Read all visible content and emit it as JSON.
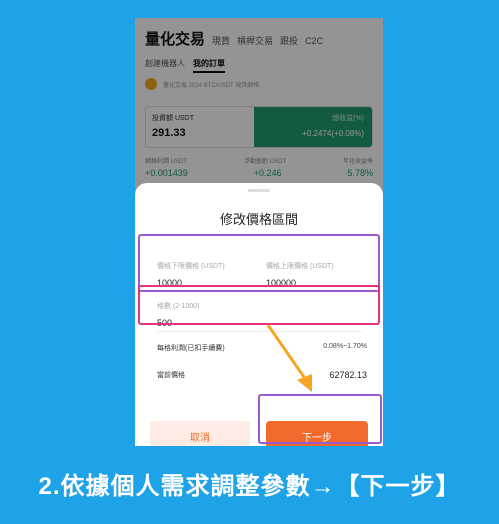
{
  "app": {
    "title": "量化交易",
    "tabs": [
      "現貨",
      "槓桿交易",
      "跟投",
      "C2C"
    ],
    "subtabs": [
      "創建機器人",
      "我的訂單"
    ],
    "coin_text": "量化交易 2024 BTC/USDT 現貨網格",
    "card": {
      "label": "投資額 USDT",
      "value": "291.33",
      "right_label": "總收益(%)",
      "right_value": "+0.2474(+0.08%)"
    },
    "stats_labels": [
      "網格利潤 USDT",
      "浮動盈虧 USDT",
      "年化收益率"
    ],
    "stats_values": [
      "+0.001439",
      "+0.246",
      "5.78%"
    ]
  },
  "sheet": {
    "title": "修改價格區間",
    "lower": {
      "label": "價格下限價格 (USDT)",
      "value": "10000"
    },
    "upper": {
      "label": "價格上限價格 (USDT)",
      "value": "100000"
    },
    "grids": {
      "label": "格數 (2-1000)",
      "value": "500"
    },
    "profit_label": "每格利潤(已扣手續費)",
    "profit_value": "0.08%~1.70%",
    "price_label": "當前價格",
    "price_value": "62782.13",
    "cancel_label": "取消",
    "next_label": "下一步"
  },
  "caption": "2.依據個人需求調整參數→【下一步】",
  "colors": {
    "background": "#1ea2e8",
    "accent": "#f26a2b",
    "highlight_purple": "#9b59d0",
    "highlight_pink": "#e8337a",
    "arrow": "#f5a623"
  }
}
